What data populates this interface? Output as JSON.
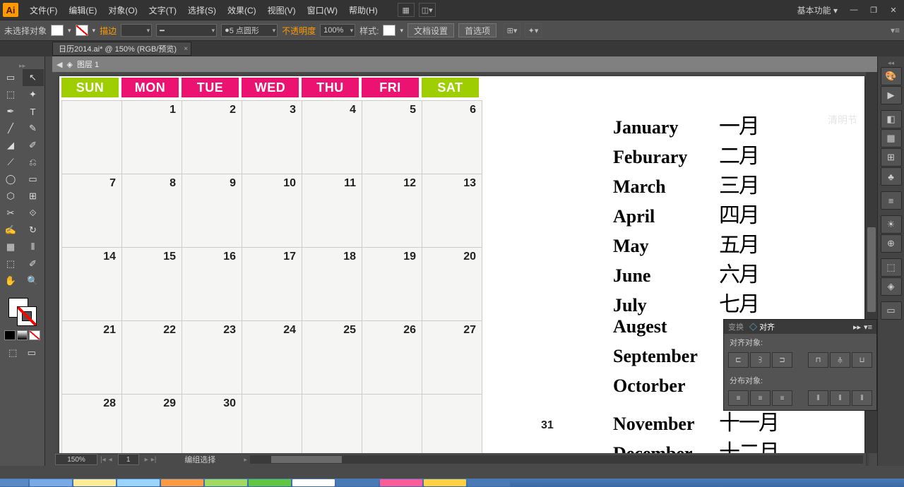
{
  "menubar": {
    "items": [
      {
        "label": "文件(F)"
      },
      {
        "label": "编辑(E)"
      },
      {
        "label": "对象(O)"
      },
      {
        "label": "文字(T)"
      },
      {
        "label": "选择(S)"
      },
      {
        "label": "效果(C)"
      },
      {
        "label": "视图(V)"
      },
      {
        "label": "窗口(W)"
      },
      {
        "label": "帮助(H)"
      }
    ],
    "workspace": "基本功能"
  },
  "controlbar": {
    "selection_status": "未选择对象",
    "stroke_label": "描边",
    "stroke_dash": "5 点圆形",
    "opacity_label": "不透明度",
    "opacity_value": "100%",
    "style_label": "样式:",
    "doc_setup": "文档设置",
    "prefs": "首选项"
  },
  "document": {
    "tab_title": "日历2014.ai* @ 150% (RGB/预览)",
    "breadcrumb_layer": "图层 1"
  },
  "calendar": {
    "days": [
      {
        "label": "SUN",
        "cls": "green"
      },
      {
        "label": "MON",
        "cls": "pink"
      },
      {
        "label": "TUE",
        "cls": "pink"
      },
      {
        "label": "WED",
        "cls": "pink"
      },
      {
        "label": "THU",
        "cls": "pink"
      },
      {
        "label": "FRI",
        "cls": "pink"
      },
      {
        "label": "SAT",
        "cls": "green"
      }
    ],
    "rows": [
      [
        "",
        "1",
        "2",
        "3",
        "4",
        "5",
        "6"
      ],
      [
        "7",
        "8",
        "9",
        "10",
        "11",
        "12",
        "13"
      ],
      [
        "14",
        "15",
        "16",
        "17",
        "18",
        "19",
        "20"
      ],
      [
        "21",
        "22",
        "23",
        "24",
        "25",
        "26",
        "27"
      ],
      [
        "28",
        "29",
        "30",
        "",
        "",
        "",
        ""
      ]
    ],
    "orphan": "31"
  },
  "months": [
    {
      "en": "January",
      "zh": "一月"
    },
    {
      "en": "Feburary",
      "zh": "二月"
    },
    {
      "en": "March",
      "zh": "三月"
    },
    {
      "en": "April",
      "zh": "四月"
    },
    {
      "en": "May",
      "zh": "五月"
    },
    {
      "en": "June",
      "zh": "六月"
    },
    {
      "en": "July",
      "zh": "七月"
    },
    {
      "en": "Augest",
      "zh": ""
    },
    {
      "en": "September",
      "zh": ""
    },
    {
      "en": "Octorber",
      "zh": ""
    },
    {
      "en": "November",
      "zh": "十一月"
    },
    {
      "en": "December",
      "zh": "十二月"
    }
  ],
  "watermark": "清明节",
  "align_panel": {
    "tab1": "变换",
    "tab2_prefix": "◇ ",
    "tab2": "对齐",
    "section1": "对齐对象:",
    "section2": "分布对象:"
  },
  "statusbar": {
    "zoom": "150%",
    "page": "1",
    "mode": "编组选择"
  },
  "tools": [
    "▭",
    "↖",
    "⬚",
    "✦",
    "✒",
    "T",
    "╱",
    "✎",
    "◢",
    "✐",
    "⟋",
    "⎌",
    "◯",
    "▭",
    "⬡",
    "⊞",
    "✂",
    "⟐",
    "✍",
    "↻",
    "▦",
    "⫴",
    "⬚",
    "✐",
    "✋",
    "🔍"
  ],
  "dock_icons": [
    "🎨",
    "▶",
    "◧",
    "▦",
    "⊞",
    "♣",
    "≡",
    "☀",
    "⊕",
    "⬚",
    "◈",
    "▭"
  ]
}
